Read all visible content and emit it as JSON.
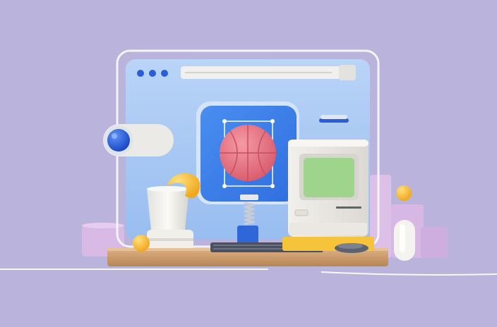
{
  "scene": {
    "background_color": "#bab4dc",
    "window_panel_color": "#a8c8f4",
    "app_tile_color": "#3a7ee8",
    "ball_color": "#e8707e",
    "monitor_screen_color": "#9ed48c",
    "keyboard_color": "#4a5060",
    "accent_yellow": "#f7c53a",
    "accent_blue": "#2a5ed8",
    "lilac_block_color": "#d7b8e4",
    "wood_color": "#c89a6a",
    "icons": [
      "browser-window",
      "window-control-dots",
      "address-bar",
      "toggle-switch",
      "app-icon-tile",
      "basketball",
      "selection-frame",
      "spring",
      "retro-computer",
      "keyboard",
      "mouse",
      "cup",
      "yellow-swoosh",
      "wooden-tray",
      "lilac-steps",
      "yellow-balls",
      "white-capsule"
    ]
  }
}
